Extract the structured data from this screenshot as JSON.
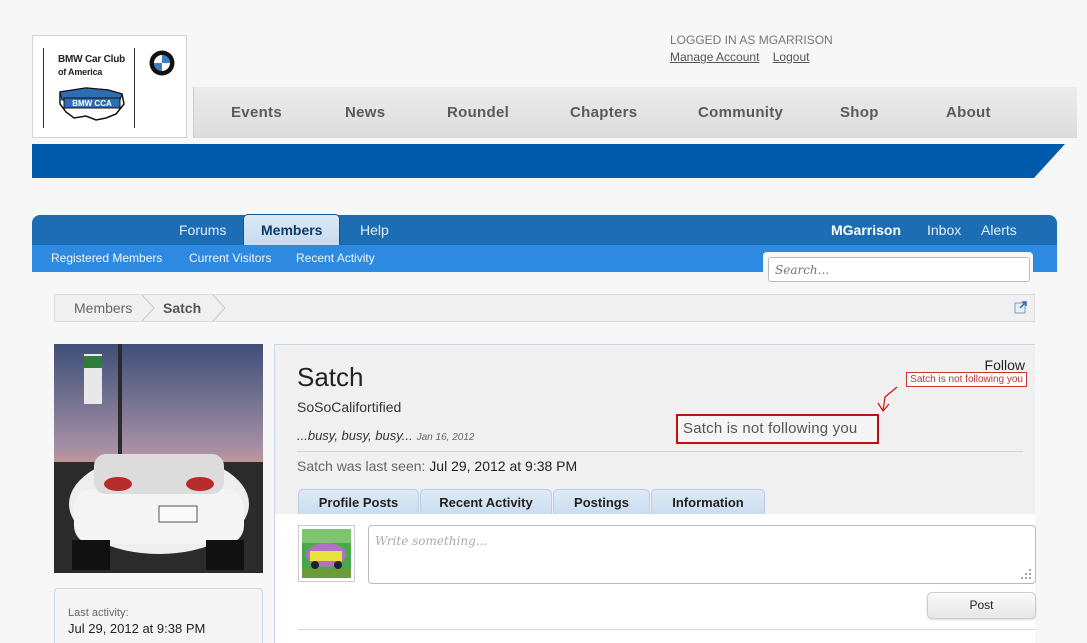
{
  "logo": {
    "line1": "BMW Car Club",
    "line2": "of America",
    "emblem_text": "BMW CCA"
  },
  "account": {
    "logged_in_as": "LOGGED IN AS MGARRISON",
    "manage_label": "Manage Account",
    "logout_label": "Logout"
  },
  "main_nav": [
    "Events",
    "News",
    "Roundel",
    "Chapters",
    "Community",
    "Shop",
    "About"
  ],
  "forum_nav": {
    "tabs": [
      "Forums",
      "Members",
      "Help"
    ],
    "active": "Members",
    "user": "MGarrison",
    "inbox": "Inbox",
    "alerts": "Alerts"
  },
  "sub_nav": [
    "Registered Members",
    "Current Visitors",
    "Recent Activity"
  ],
  "search": {
    "placeholder": "Search..."
  },
  "breadcrumb": [
    "Members",
    "Satch"
  ],
  "profile": {
    "username": "Satch",
    "title": "SoSoCalifortified",
    "status": "...busy, busy, busy...",
    "status_date": "Jan 16, 2012",
    "last_seen_label": "Satch was last seen:",
    "last_seen_value": "Jul 29, 2012 at 9:38 PM",
    "follow_label": "Follow",
    "follow_note": "Satch is not following you",
    "annotation": "Satch is not following you"
  },
  "profile_tabs": [
    "Profile Posts",
    "Recent Activity",
    "Postings",
    "Information"
  ],
  "activity": {
    "label": "Last activity:",
    "value": "Jul 29, 2012 at 9:38 PM"
  },
  "composer": {
    "placeholder": "Write something...",
    "post_label": "Post"
  },
  "colors": {
    "brand_blue": "#005aab",
    "forum_nav": "#1c6db3",
    "sub_nav": "#2d8ae0",
    "annotation_red": "#b11111"
  }
}
